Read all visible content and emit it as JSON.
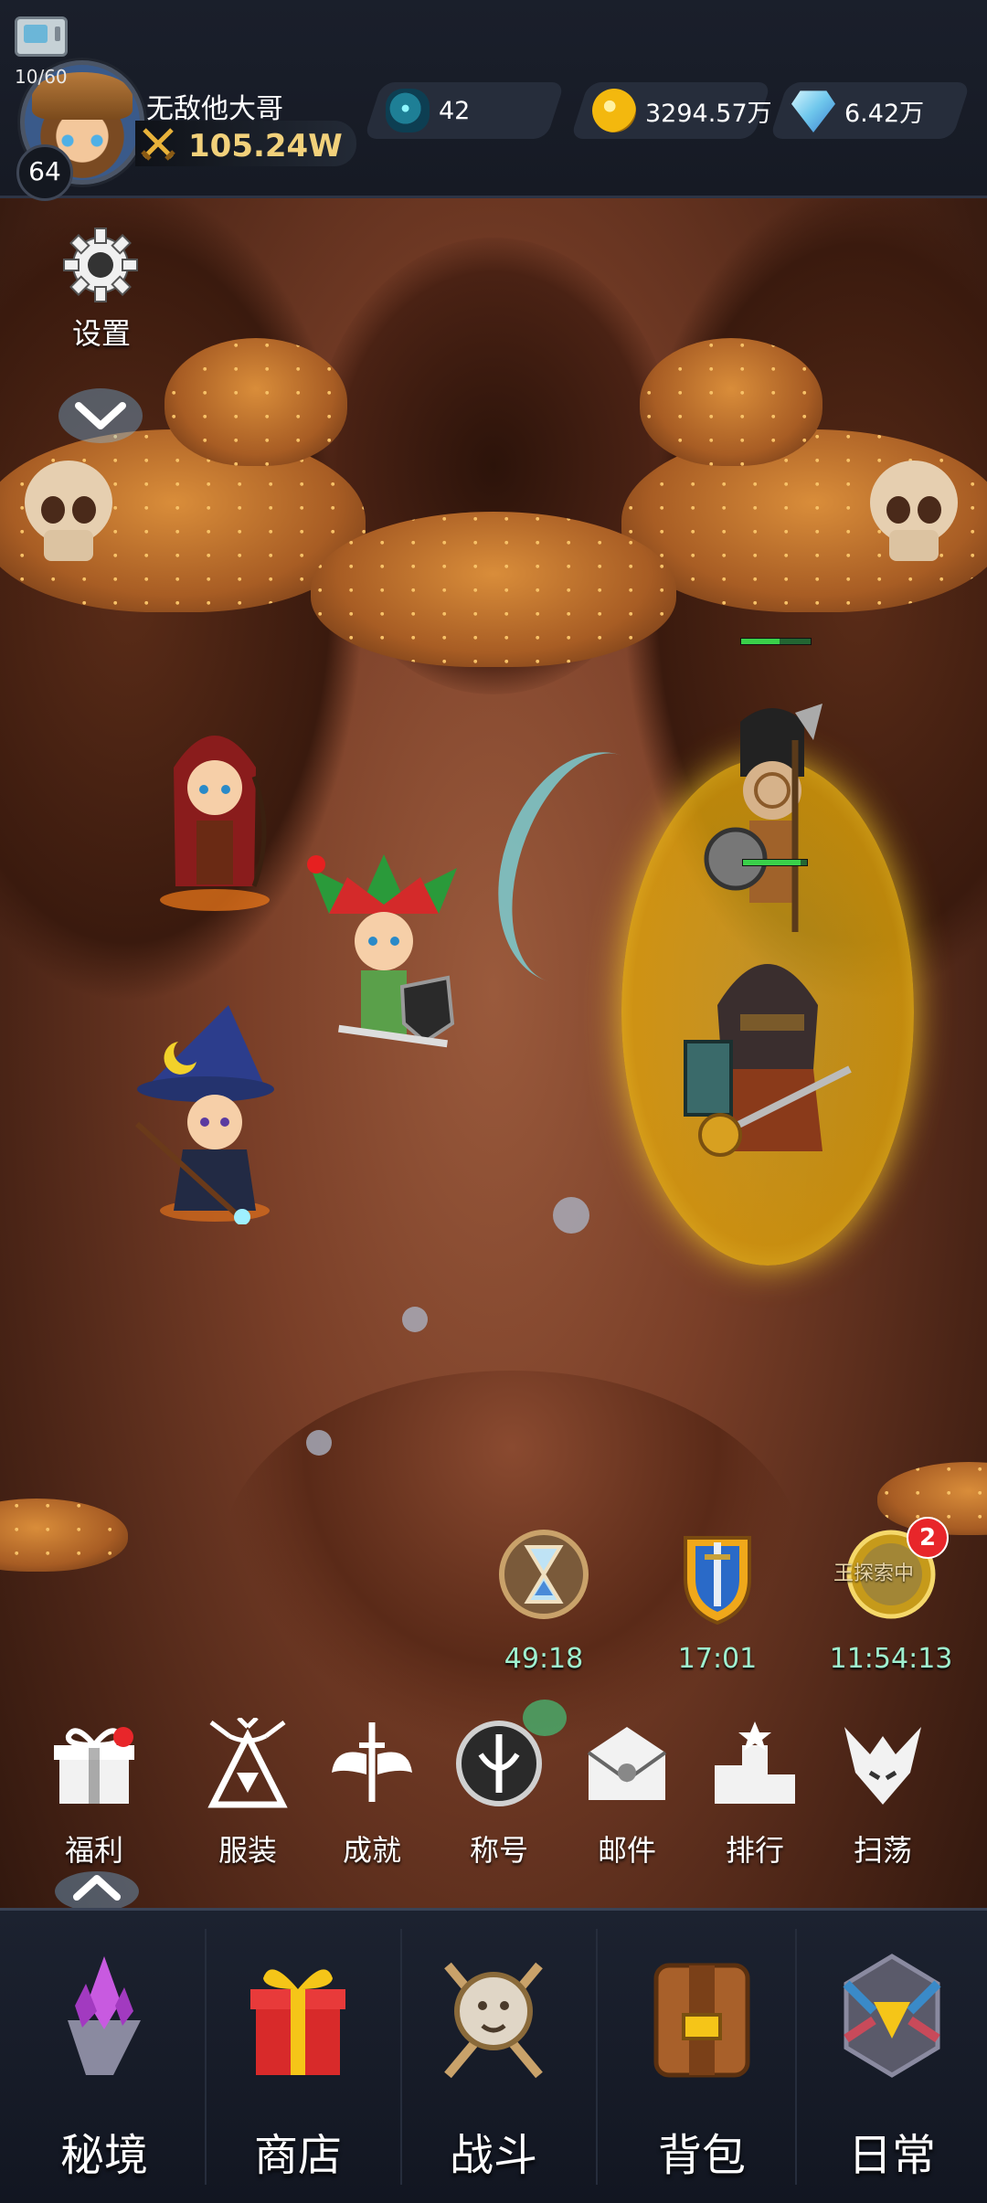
{
  "top_bar": {
    "stamina": "10/60",
    "player_name": "无敌他大哥",
    "level": "64",
    "combat_power": "105.24W",
    "resources": [
      {
        "name": "gem",
        "icon": "teal-gem-icon",
        "value": "42"
      },
      {
        "name": "gold",
        "icon": "gold-coin-icon",
        "value": "3294.57万"
      },
      {
        "name": "diamond",
        "icon": "diamond-icon",
        "value": "6.42万"
      }
    ]
  },
  "settings": {
    "label": "设置",
    "icon": "gear-icon"
  },
  "battle": {
    "enemy_hp_fraction": 0.55,
    "enemy2_hp_fraction": 0.9
  },
  "events": [
    {
      "name": "hourglass-event",
      "icon": "hourglass-icon",
      "time": "49:18"
    },
    {
      "name": "sword-shield-event",
      "icon": "sword-shield-icon",
      "time": "17:01"
    },
    {
      "name": "exploration-event",
      "icon": "compass-icon",
      "emblem_text": "王探索中",
      "time": "11:54:13",
      "badge": "2"
    }
  ],
  "menu": [
    {
      "name": "welfare",
      "label": "福利",
      "icon": "gift-icon",
      "has_dot": true
    },
    {
      "name": "outfit",
      "label": "服装",
      "icon": "deer-emblem-icon"
    },
    {
      "name": "achievement",
      "label": "成就",
      "icon": "winged-sword-icon"
    },
    {
      "name": "title",
      "label": "称号",
      "icon": "title-medal-icon"
    },
    {
      "name": "mail",
      "label": "邮件",
      "icon": "envelope-icon"
    },
    {
      "name": "rank",
      "label": "排行",
      "icon": "podium-icon"
    },
    {
      "name": "sweep",
      "label": "扫荡",
      "icon": "dragon-mask-icon"
    }
  ],
  "bottom_nav": [
    {
      "name": "secret-realm",
      "label": "秘境",
      "icon": "crystal-island-icon"
    },
    {
      "name": "shop",
      "label": "商店",
      "icon": "gift-box-icon"
    },
    {
      "name": "battle",
      "label": "战斗",
      "icon": "lion-crest-icon"
    },
    {
      "name": "backpack",
      "label": "背包",
      "icon": "backpack-icon"
    },
    {
      "name": "daily",
      "label": "日常",
      "icon": "daily-emblem-icon"
    }
  ],
  "colors": {
    "accent_timer": "#9ff0cf",
    "power_gold": "#f2d17b",
    "badge_red": "#e8262a"
  }
}
